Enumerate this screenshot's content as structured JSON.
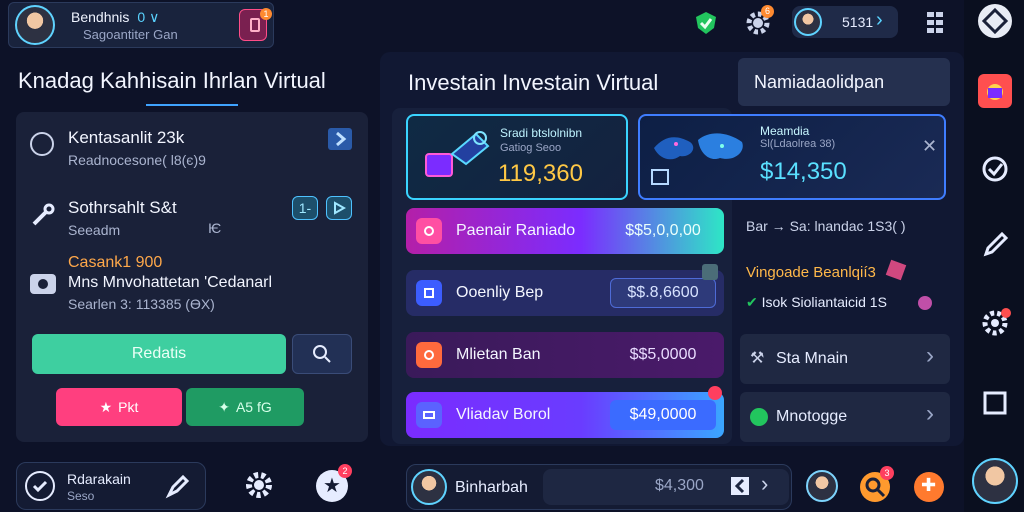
{
  "profile": {
    "name": "Bendhnis",
    "icons": "0  ∨",
    "subtitle": "Sagoantiter Gan",
    "badge": "1"
  },
  "topbar": {
    "shield_icon": "shield-check-icon",
    "gear_badge": "6",
    "user_value": "5131",
    "chevron": "›"
  },
  "left": {
    "title": "Knadag Kahhisain Ihrlan Virtual",
    "items": [
      {
        "title": "Kentasanlit 23k",
        "sub": "Readnocesone( l8(є)9"
      },
      {
        "title": "Sothrsahlt S&t",
        "sub": "Seeadm",
        "extra": "Ѥ",
        "btn1": "1-"
      },
      {
        "title_accent": "Casank1 900",
        "title": "Mns Mnvohattetan 'Cedanarl",
        "sub": "Searlen 3: 113385 (ӨX)"
      }
    ],
    "primary_button": "Redatis",
    "pink_button": "Pkt",
    "green_button": "A5 fG"
  },
  "center": {
    "title": "Investain Investain Virtual",
    "card1": {
      "label": "Sradi btslolnibn",
      "sub": "Gatiog Seoo",
      "value": "119,360"
    },
    "card2": {
      "label": "Meamdia",
      "sub": "Sl(Ldaolrea 38)",
      "value": "$14,350"
    },
    "rows": [
      {
        "label": "Paenair Raniado",
        "amount": "$$5,0,0,00"
      },
      {
        "label": "Ooenliy Bep",
        "amount": "$$.8,6600"
      },
      {
        "label": "Mlietan Ban",
        "amount": "$$5,0000"
      },
      {
        "label": "Vliadav Borol",
        "amount": "$49,0000"
      }
    ]
  },
  "right": {
    "tab": "Namiadaolidpan",
    "note": "Bar → Sa: lnandac 1S3( )",
    "promo_title": "Vingoade Beanlqií3",
    "promo_sub": "Isok Sioliantaicid 1S",
    "menu": [
      {
        "label": "Sta Mnain",
        "chevron": "›"
      },
      {
        "label": "Mnotogge",
        "chevron": "›"
      }
    ]
  },
  "bottom": {
    "left_title": "Rdarakain",
    "left_sub": "Seso",
    "badge": "2",
    "user_label": "Binharbah",
    "amount": "$4,300",
    "badge2": "3"
  },
  "colors": {
    "bg": "#0d1228",
    "panel": "#1a2139",
    "accent": "#41d6a6",
    "pink": "#ff3f7f",
    "purple": "#7b2cff"
  }
}
